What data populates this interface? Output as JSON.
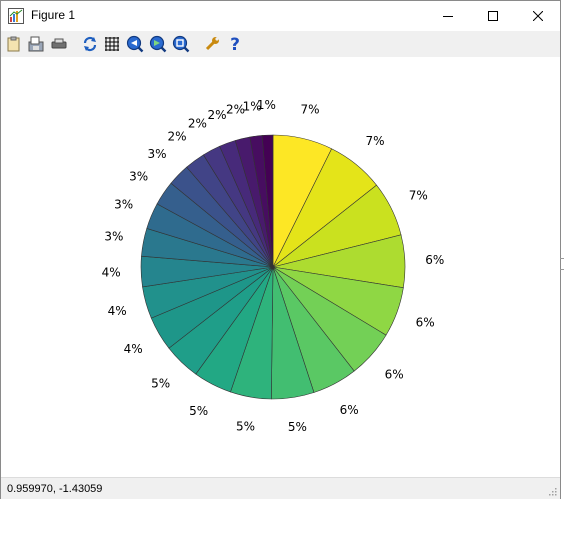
{
  "window": {
    "title": "Figure 1",
    "controls": [
      "minimize",
      "maximize",
      "close"
    ]
  },
  "toolbar": {
    "items": [
      {
        "name": "copy-icon",
        "tooltip": ""
      },
      {
        "name": "save-icon",
        "tooltip": ""
      },
      {
        "name": "print-icon",
        "tooltip": ""
      },
      {
        "name": "refresh-icon",
        "tooltip": ""
      },
      {
        "name": "grid-icon",
        "tooltip": ""
      },
      {
        "name": "zoom-in-icon",
        "tooltip": ""
      },
      {
        "name": "zoom-out-icon",
        "tooltip": ""
      },
      {
        "name": "zoom-fit-icon",
        "tooltip": ""
      },
      {
        "name": "settings-wrench-icon",
        "tooltip": ""
      },
      {
        "name": "help-icon",
        "tooltip": ""
      }
    ]
  },
  "status": {
    "coordinates": "0.959970, -1.43059"
  },
  "chart_data": {
    "type": "pie",
    "title": "",
    "start_angle_deg": 90,
    "direction": "clockwise",
    "colormap": "viridis",
    "edge_color": "#333333",
    "labels_shown": [
      "7%",
      "7%",
      "7%",
      "6%",
      "6%",
      "6%",
      "6%",
      "5%",
      "5%",
      "5%",
      "5%",
      "4%",
      "4%",
      "4%",
      "3%",
      "3%",
      "3%",
      "3%",
      "2%",
      "2%",
      "2%",
      "2%",
      "1%",
      "1%"
    ],
    "values": [
      7.3,
      7.0,
      6.7,
      6.4,
      6.1,
      5.8,
      5.5,
      5.2,
      5.0,
      4.7,
      4.5,
      4.2,
      3.9,
      3.7,
      3.4,
      3.2,
      3.0,
      2.7,
      2.5,
      2.2,
      2.0,
      1.8,
      1.5,
      1.3
    ],
    "colors": [
      "#fde725",
      "#e4e419",
      "#cae11f",
      "#addc30",
      "#8fd744",
      "#73d056",
      "#5ac864",
      "#42be71",
      "#2eb37c",
      "#22a884",
      "#1f9e89",
      "#1e9689",
      "#21918c",
      "#25858e",
      "#2a788e",
      "#2f6b8e",
      "#355f8d",
      "#3b528b",
      "#414487",
      "#453882",
      "#472a7a",
      "#481a6c",
      "#470d60",
      "#440154"
    ]
  }
}
